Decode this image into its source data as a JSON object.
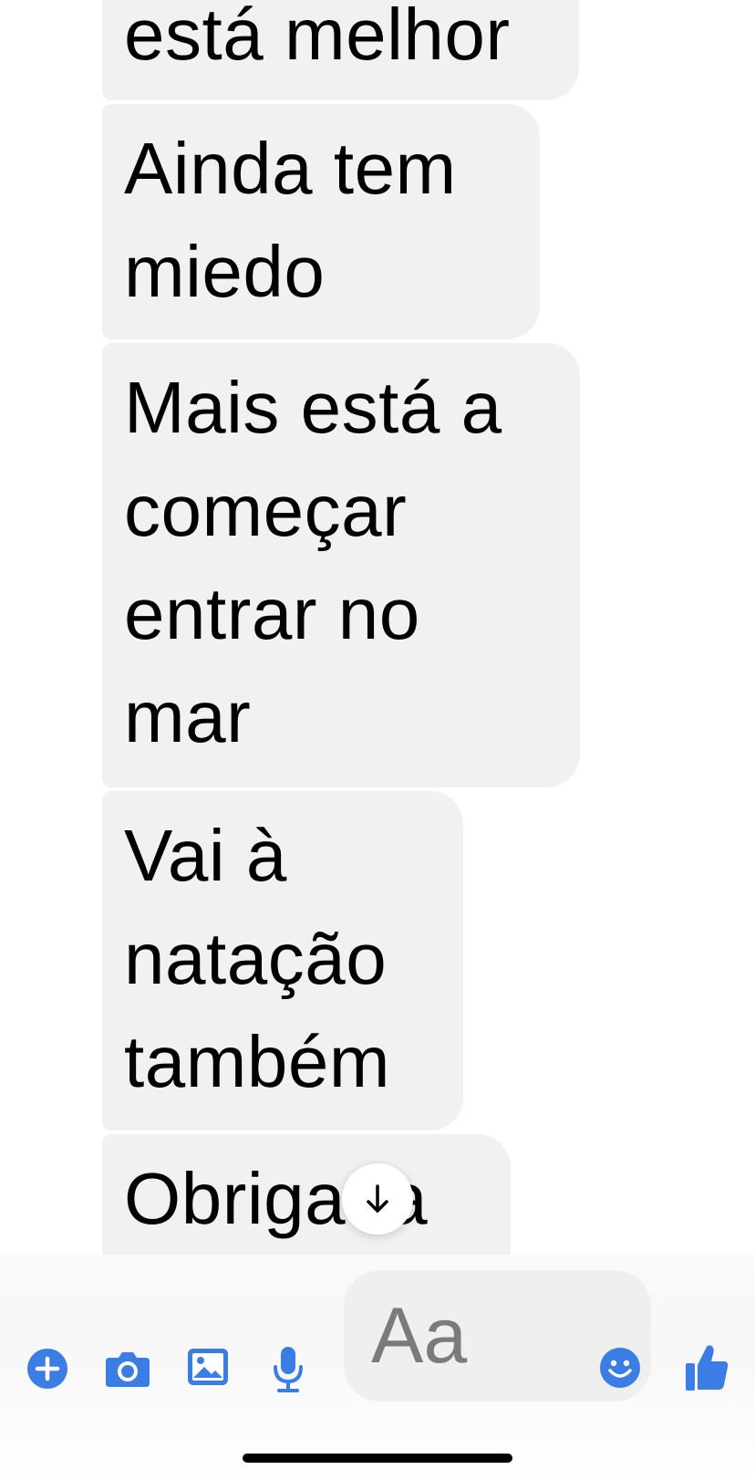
{
  "messages": [
    {
      "text": "está melhor"
    },
    {
      "text": "Ainda tem\nmiedo"
    },
    {
      "text": "Mais está a\ncomeçar\nentrar no\nmar"
    },
    {
      "text": "Vai à\nnatação\ntambém"
    },
    {
      "text": "Obrigada"
    }
  ],
  "composer": {
    "placeholder": "Aa",
    "icons": [
      "plus-icon",
      "camera-icon",
      "photo-icon",
      "microphone-icon",
      "emoji-icon",
      "thumbs-up-icon"
    ]
  },
  "colors": {
    "accent": "#3b7de5",
    "bubble": "#f1f1f1",
    "input": "#efefef"
  }
}
